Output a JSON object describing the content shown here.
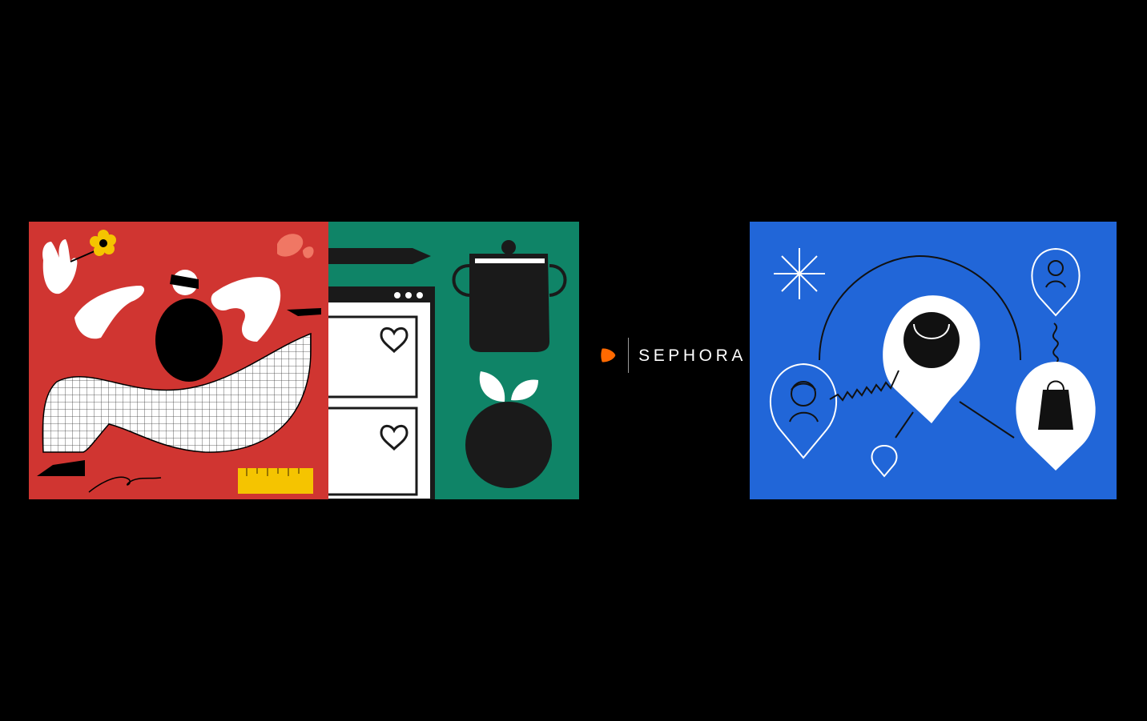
{
  "brand": {
    "partner_logo_text": "SEPHORA",
    "partner_logo_icon": "zalando-play-icon"
  },
  "illustrations": [
    {
      "name": "red-illustration",
      "colors": [
        "#d03531",
        "#ffffff",
        "#000000",
        "#f5d000",
        "#f07764"
      ],
      "icons": [
        "waving-hand-icon",
        "flower-icon",
        "character-figure-icon",
        "grid-fabric-icon",
        "ruler-icon",
        "shoe-icon"
      ]
    },
    {
      "name": "green-illustration",
      "colors": [
        "#0f8467",
        "#ffffff",
        "#1a1a1a"
      ],
      "icons": [
        "arrow-banner-icon",
        "browser-window-icon",
        "heart-icon",
        "cooking-pot-icon",
        "plant-seedling-icon"
      ]
    },
    {
      "name": "blue-illustration",
      "colors": [
        "#2166d8",
        "#ffffff",
        "#111111"
      ],
      "icons": [
        "sparkle-icon",
        "location-pin-icon",
        "user-pin-icon",
        "shopping-bag-icon",
        "connection-line-icon"
      ]
    }
  ],
  "colors": {
    "background": "#000000",
    "zalando_orange": "#ff6900",
    "text": "#ffffff"
  }
}
